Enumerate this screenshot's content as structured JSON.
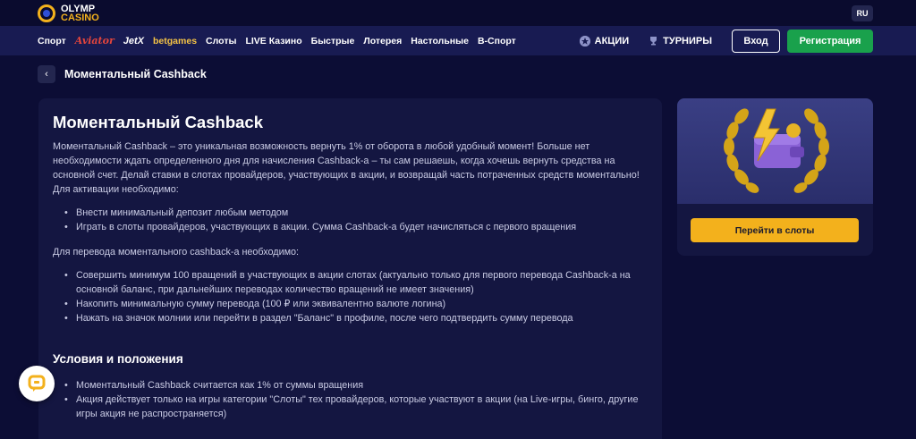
{
  "header": {
    "logo_line1": "OLYMP",
    "logo_line2": "CASINO",
    "lang": "RU"
  },
  "nav": {
    "links": [
      "Спорт",
      "Aviator",
      "JetX",
      "betgames",
      "Слоты",
      "LIVE Казино",
      "Быстрые",
      "Лотерея",
      "Настольные",
      "В-Спорт"
    ],
    "promos_label": "АКЦИИ",
    "tournaments_label": "ТУРНИРЫ",
    "login_label": "Вход",
    "register_label": "Регистрация"
  },
  "breadcrumb": {
    "back": "‹",
    "title": "Моментальный Cashback"
  },
  "article": {
    "title": "Моментальный Cashback",
    "intro": "Моментальный Cashback – это уникальная возможность вернуть 1% от оборота в любой удобный момент! Больше нет необходимости ждать определенного дня для начисления Cashback-а – ты сам решаешь, когда хочешь вернуть средства на основной счет. Делай ставки в слотах провайдеров, участвующих в акции, и возвращай часть потраченных средств моментально!",
    "activation_heading": "Для активации необходимо:",
    "activation_items": [
      "Внести минимальный депозит любым методом",
      "Играть в слоты провайдеров, участвующих в акции. Сумма Cashback-а будет начисляться с первого вращения"
    ],
    "transfer_heading": "Для перевода моментального cashback-а необходимо:",
    "transfer_items": [
      "Совершить минимум 100 вращений в участвующих в акции слотах (актуально только для первого перевода Cashback-а на основной баланс, при дальнейших переводах количество вращений не имеет значения)",
      "Накопить минимальную сумму перевода (100 ₽ или эквивалентно валюте логина)",
      "Нажать на значок молнии или перейти в раздел \"Баланс\" в профиле, после чего подтвердить сумму перевода"
    ],
    "terms_title": "Условия и положения",
    "terms_items": [
      "Моментальный Cashback считается как 1% от суммы вращения",
      "Акция действует только на игры категории \"Слоты\" тех провайдеров, которые участвуют в акции (на Live-игры, бинго, другие игры акция не распространяется)"
    ]
  },
  "side_card": {
    "cta_label": "Перейти в слоты"
  },
  "icons": {
    "promo": "promo-icon",
    "trophy": "trophy-icon",
    "chat": "chat-icon",
    "back": "chevron-left-icon"
  },
  "colors": {
    "background": "#0c0d35",
    "nav_background": "#181b52",
    "accent_green": "#19a14c",
    "accent_gold": "#f3b11c",
    "card": "#141641"
  }
}
